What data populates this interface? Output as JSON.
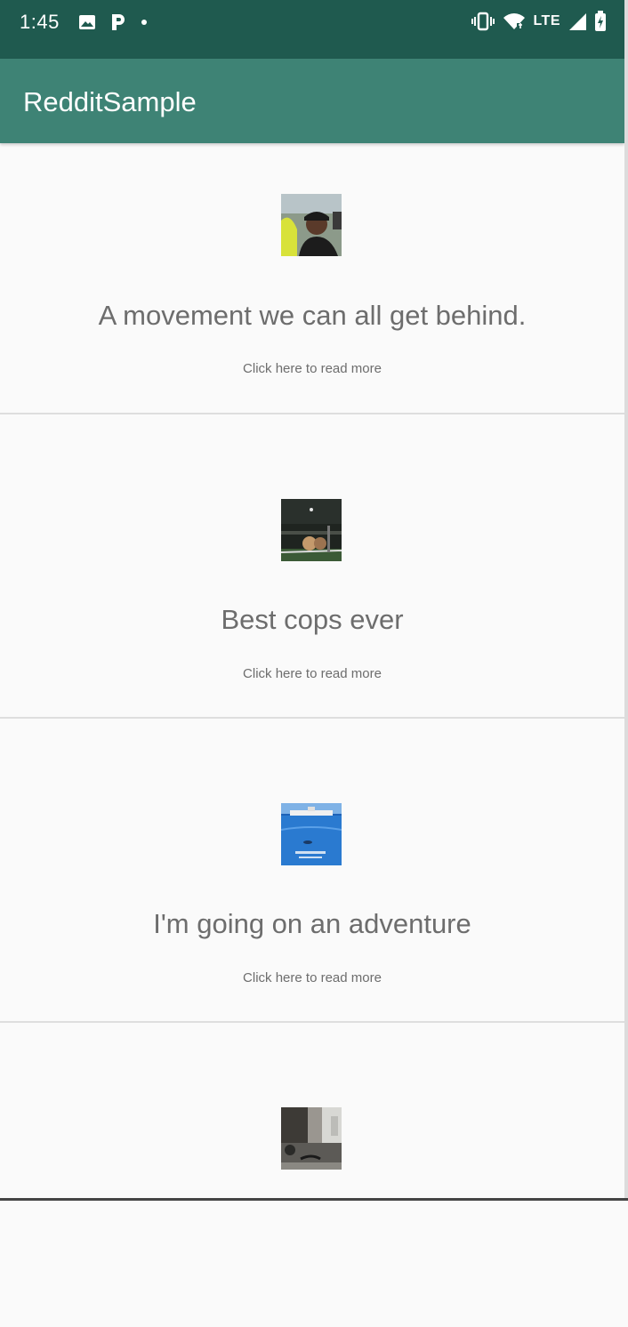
{
  "status_bar": {
    "time": "1:45",
    "network_label": "LTE",
    "icons": [
      "image-notification-icon",
      "p-notification-icon",
      "dot-icon",
      "vibrate-icon",
      "wifi-icon",
      "signal-icon",
      "battery-icon"
    ]
  },
  "app_bar": {
    "title": "RedditSample",
    "color": "#3e8375"
  },
  "posts": [
    {
      "title": "A movement we can all get behind.",
      "link_text": "Click here to read more",
      "thumbnail": "person-photo-thumbnail"
    },
    {
      "title": "Best cops ever",
      "link_text": "Click here to read more",
      "thumbnail": "night-scene-thumbnail"
    },
    {
      "title": "I'm going on an adventure",
      "link_text": "Click here to read more",
      "thumbnail": "ocean-ship-thumbnail"
    },
    {
      "title": "",
      "link_text": "",
      "thumbnail": "room-scene-thumbnail"
    }
  ]
}
